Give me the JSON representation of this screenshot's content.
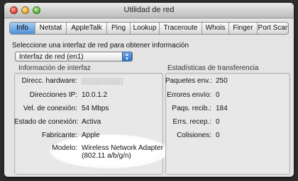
{
  "window": {
    "title": "Utilidad de red"
  },
  "tabs": [
    {
      "label": "Info"
    },
    {
      "label": "Netstat"
    },
    {
      "label": "AppleTalk"
    },
    {
      "label": "Ping"
    },
    {
      "label": "Lookup"
    },
    {
      "label": "Traceroute"
    },
    {
      "label": "Whois"
    },
    {
      "label": "Finger"
    },
    {
      "label": "Port Scan"
    }
  ],
  "interface_prompt": "Seleccione una interfaz de red para obtener información",
  "interface_select": {
    "value": "Interfaz de red (en1)"
  },
  "interface_info": {
    "heading": "Información de interfaz",
    "rows": [
      {
        "label": "Direcc. hardware:",
        "value": ""
      },
      {
        "label": "Direcciones IP:",
        "value": "10.0.1.2"
      },
      {
        "label": "Vel. de conexión:",
        "value": "54 Mbps"
      },
      {
        "label": "Estado de conexión:",
        "value": "Activa"
      },
      {
        "label": "Fabricante:",
        "value": "Apple"
      },
      {
        "label": "Modelo:",
        "value": "Wireless Network Adapter",
        "value2": "(802.11 a/b/g/n)"
      }
    ]
  },
  "transfer_stats": {
    "heading": "Estadísticas de transferencia",
    "rows": [
      {
        "label": "Paquetes env.:",
        "value": "250"
      },
      {
        "label": "Errores envío:",
        "value": "0"
      },
      {
        "label": "Paqs. recib.:",
        "value": "184"
      },
      {
        "label": "Errs. recep.:",
        "value": "0"
      },
      {
        "label": "Colisiones:",
        "value": "0"
      }
    ]
  }
}
